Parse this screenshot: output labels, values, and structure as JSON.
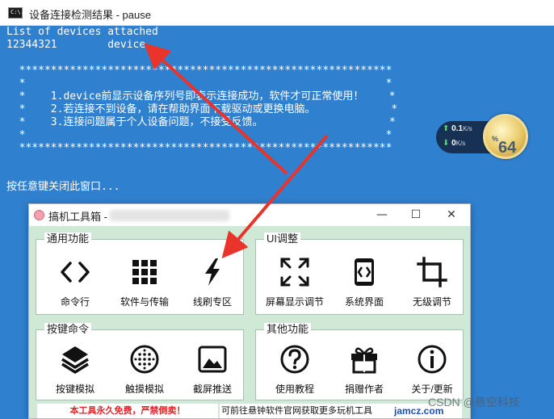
{
  "console": {
    "title": "设备连接检测结果 - pause",
    "icon_text": "C:\\.",
    "lines": [
      "List of devices attached",
      "12344321        device",
      "",
      "  ***********************************************************",
      "  *                                                         *",
      "  *    1.device前显示设备序列号即表示连接成功，软件才可正常使用！    *",
      "  *    2.若连接不到设备，请在帮助界面下载驱动或更换电脑。            *",
      "  *    3.连接问题属于个人设备问题，不接受反馈。                    *",
      "  *                                                         *",
      "  ***********************************************************",
      "",
      "",
      "按任意键关闭此窗口..."
    ]
  },
  "speed_widget": {
    "up_value": "0.1",
    "up_unit": "K/s",
    "down_value": "0",
    "down_unit": "K/s",
    "gauge_value": "64",
    "gauge_unit": "%"
  },
  "tool_window": {
    "title": "搞机工具箱 -",
    "min": "—",
    "max": "☐",
    "close": "✕",
    "groups": {
      "general": {
        "label": "通用功能",
        "buttons": [
          {
            "label": "命令行",
            "icon": "code-icon"
          },
          {
            "label": "软件与传输",
            "icon": "grid-icon"
          },
          {
            "label": "线刷专区",
            "icon": "lightning-icon"
          }
        ]
      },
      "ui": {
        "label": "UI调整",
        "buttons": [
          {
            "label": "屏幕显示调节",
            "icon": "expand-icon"
          },
          {
            "label": "系统界面",
            "icon": "phone-code-icon"
          },
          {
            "label": "无级调节",
            "icon": "crop-icon"
          }
        ]
      },
      "keys": {
        "label": "按键命令",
        "buttons": [
          {
            "label": "按键模拟",
            "icon": "layers-icon"
          },
          {
            "label": "触摸模拟",
            "icon": "touch-icon"
          },
          {
            "label": "截屏推送",
            "icon": "image-icon"
          }
        ]
      },
      "other": {
        "label": "其他功能",
        "buttons": [
          {
            "label": "使用教程",
            "icon": "help-icon"
          },
          {
            "label": "捐赠作者",
            "icon": "gift-icon"
          },
          {
            "label": "关于/更新",
            "icon": "info-icon"
          }
        ]
      }
    },
    "footer_left": "本工具永久免费，严禁倒卖！",
    "footer_right": "可前往悬钟软件官网获取更多玩机工具"
  },
  "watermarks": {
    "jamcz": "jamcz.com",
    "csdn": "CSDN @悬空科技"
  },
  "colors": {
    "console_bg": "#2f80cf",
    "tool_bg": "#cfe9d6",
    "arrow": "#e8342a",
    "footer_red": "#e0262a"
  }
}
